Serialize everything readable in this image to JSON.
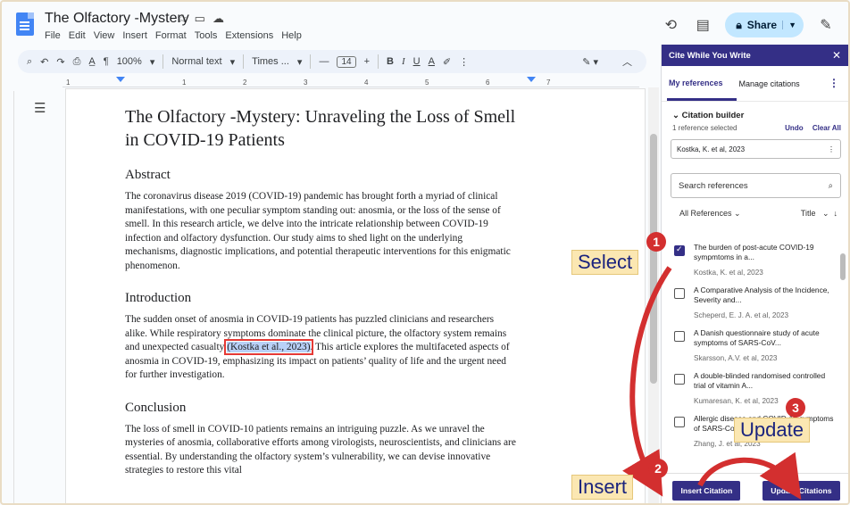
{
  "app": {
    "doc_title": "The Olfactory -Mystery",
    "menu": [
      "File",
      "Edit",
      "View",
      "Insert",
      "Format",
      "Tools",
      "Extensions",
      "Help"
    ],
    "share_label": "Share"
  },
  "toolbar": {
    "zoom": "100%",
    "style": "Normal text",
    "font": "Times ...",
    "font_size": "14",
    "minus": "—",
    "plus": "+",
    "bold": "B",
    "italic": "I",
    "underline": "U",
    "textcolor": "A"
  },
  "ruler": {
    "ticks": [
      "1",
      "1",
      "2",
      "3",
      "4",
      "5",
      "6",
      "7"
    ]
  },
  "document": {
    "title": "The Olfactory -Mystery: Unraveling the Loss of Smell in COVID-19 Patients",
    "abstract_heading": "Abstract",
    "abstract_text": "The coronavirus disease 2019 (COVID-19) pandemic has brought forth a myriad of clinical manifestations, with one peculiar symptom standing out: anosmia, or the loss of the sense of smell. In this research article, we delve into the intricate relationship between COVID-19 infection and olfactory dysfunction. Our study aims to shed light on the underlying mechanisms, diagnostic implications, and potential therapeutic interventions for this enigmatic phenomenon.",
    "intro_heading": "Introduction",
    "intro_before": "The sudden onset of anosmia in COVID-19 patients has puzzled clinicians and researchers alike. While respiratory symptoms dominate the clinical picture, the olfactory system remains and unexpected casualty ",
    "intro_citation": "(Kostka et al., 2023)",
    "intro_after": ". This article explores the multifaceted aspects of anosmia in COVID-19, emphasizing its impact on patients’ quality of life and the urgent need for further investigation.",
    "conclusion_heading": "Conclusion",
    "conclusion_text": "The loss of smell in COVID-10 patients remains an intriguing puzzle. As we unravel the mysteries of anosmia, collaborative efforts among virologists, neuroscientists, and clinicians are essential. By understanding the olfactory system’s vulnerability, we can devise innovative strategies to restore this vital"
  },
  "panel": {
    "header": "Cite While You Write",
    "tab_refs": "My references",
    "tab_manage": "Manage citations",
    "builder_title": "Citation builder",
    "selected_count": "1 reference selected",
    "undo": "Undo",
    "clear_all": "Clear All",
    "selected_ref": "Kostka, K. et al, 2023",
    "search_placeholder": "Search references",
    "filter_all": "All References",
    "filter_sort": "Title",
    "references": [
      {
        "title": "The burden of post-acute COVID-19 sympmtoms in a...",
        "meta": "Kostka, K. et al, 2023",
        "checked": true
      },
      {
        "title": "A Comparative Analysis of the Incidence, Severity and...",
        "meta": "Scheperd, E. J. A. et al, 2023",
        "checked": false
      },
      {
        "title": "A Danish questionnaire study of acute symptoms of SARS-CoV...",
        "meta": "Skarsson, A.V. et al, 2023",
        "checked": false
      },
      {
        "title": "A double-blinded randomised controlled trial of vitamin A...",
        "meta": "Kumaresan, K. et al, 2023",
        "checked": false
      },
      {
        "title": "Allergic disease and COVID-19 symptoms of SARS-CoV2...",
        "meta": "Zhang, J. et al, 2023",
        "checked": false
      }
    ],
    "insert_btn": "Insert Citation",
    "update_btn": "Update Citations"
  },
  "annotations": {
    "select_label": "Select",
    "insert_label": "Insert",
    "update_label": "Update",
    "badge1": "1",
    "badge2": "2",
    "badge3": "3"
  },
  "colors": {
    "panel_accent": "#342f86",
    "arrow_red": "#d32f2f",
    "callout_bg": "#fbe7b2",
    "share_bg": "#c2e7ff"
  }
}
